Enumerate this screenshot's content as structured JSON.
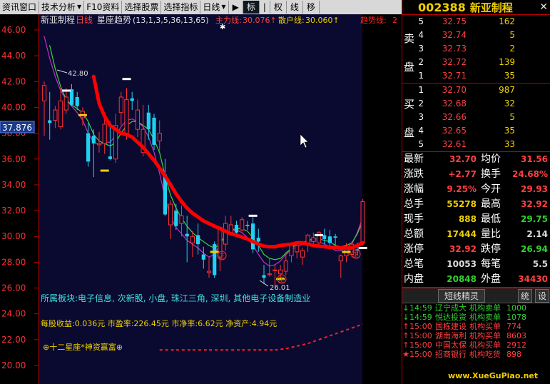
{
  "toolbar": {
    "items": [
      "资讯窗口",
      "技术分析",
      "F10资料",
      "选择股票",
      "选择指标",
      "日线"
    ],
    "play": "▶",
    "mark": "标",
    "tools": [
      "|",
      "权",
      "线",
      "移"
    ]
  },
  "chart": {
    "header": {
      "name": "新亚制程",
      "period": "日线",
      "indicator": "星座趋势",
      "params": "(13,1,3,5,36,13,65)",
      "zhuli_label": "主力线:",
      "zhuli_value": "30.076↑",
      "sanhu_label": "散户线:",
      "sanhu_value": "30.060↑",
      "qushi_label": "趋势线:",
      "qushi_value": "2"
    },
    "current_price_tag": "37.876",
    "high_mark": "42.80",
    "low_mark": "26.01",
    "zheng_glyph": "正",
    "sector_text": "所属板块:电子信息, 次新股, 小盘, 珠江三角, 深圳, 其他电子设备制造业",
    "finance_text": "每股收益:0.036元 市盈率:226.45元 市净率:6.62元 净资产:4.94元",
    "zodiac_text": "⊕十二星座*神资赢富⊕"
  },
  "chart_data": {
    "type": "candlestick",
    "ylim": [
      19,
      47
    ],
    "yticks": [
      "46.00",
      "44.00",
      "42.00",
      "40.00",
      "38.00",
      "36.00",
      "34.00",
      "32.00",
      "30.00",
      "28.00",
      "26.00",
      "24.00",
      "22.00",
      "20.00"
    ],
    "candles": [
      [
        40.5,
        42.0,
        37.8,
        41.7
      ],
      [
        39.0,
        41.2,
        37.5,
        38.8
      ],
      [
        39.0,
        40.1,
        38.4,
        39.8
      ],
      [
        38.5,
        41.5,
        38.3,
        40.5
      ],
      [
        39.8,
        41.5,
        39.5,
        40.8
      ],
      [
        41.4,
        41.8,
        40.1,
        40.2
      ],
      [
        40.8,
        41.2,
        39.8,
        40.1
      ],
      [
        39.2,
        40.0,
        38.6,
        39.7
      ],
      [
        38.0,
        38.8,
        35.4,
        35.8
      ],
      [
        37.8,
        38.3,
        34.6,
        37.2
      ],
      [
        37.1,
        38.1,
        36.5,
        37.2
      ],
      [
        37.2,
        39.4,
        36.4,
        38.7
      ],
      [
        36.2,
        38.9,
        35.9,
        36.0
      ],
      [
        36.0,
        39.5,
        35.7,
        38.6
      ],
      [
        39.6,
        41.2,
        38.6,
        40.8
      ],
      [
        38.0,
        41.5,
        37.5,
        40.6
      ],
      [
        40.7,
        41.2,
        39.8,
        40.5
      ],
      [
        38.3,
        40.6,
        37.7,
        39.8
      ],
      [
        36.5,
        40.2,
        36.2,
        38.3
      ],
      [
        39.6,
        40.2,
        37.5,
        38.3
      ],
      [
        39.2,
        39.5,
        36.7,
        37.1
      ],
      [
        37.4,
        39.0,
        36.6,
        38.0
      ],
      [
        34.8,
        36.0,
        31.6,
        31.7
      ],
      [
        30.9,
        32.8,
        29.8,
        32.5
      ],
      [
        32.0,
        32.5,
        30.5,
        30.8
      ],
      [
        31.0,
        32.4,
        30.0,
        31.6
      ],
      [
        30.2,
        31.6,
        28.0,
        30.0
      ],
      [
        29.5,
        30.4,
        28.4,
        30.0
      ],
      [
        30.1,
        31.0,
        28.6,
        29.4
      ],
      [
        28.6,
        29.2,
        27.5,
        28.2
      ],
      [
        27.2,
        28.4,
        26.8,
        27.3
      ],
      [
        29.4,
        29.6,
        26.8,
        27.0
      ],
      [
        28.4,
        30.8,
        27.3,
        30.7
      ],
      [
        29.4,
        31.6,
        28.9,
        31.0
      ],
      [
        30.3,
        31.6,
        30.1,
        30.9
      ],
      [
        30.9,
        31.2,
        30.2,
        30.3
      ],
      [
        30.5,
        31.5,
        30.4,
        31.3
      ],
      [
        30.9,
        31.2,
        30.5,
        30.8
      ],
      [
        31.0,
        31.5,
        28.7,
        29.0
      ],
      [
        29.9,
        30.6,
        28.8,
        29.6
      ],
      [
        27.0,
        27.8,
        26.3,
        26.8
      ],
      [
        27.1,
        28.3,
        26.9,
        27.1
      ],
      [
        27.4,
        27.8,
        26.2,
        27.4
      ],
      [
        27.1,
        27.8,
        26.6,
        27.4
      ],
      [
        27.3,
        28.8,
        27.0,
        28.1
      ],
      [
        28.5,
        29.5,
        28.0,
        29.4
      ],
      [
        28.8,
        29.6,
        28.3,
        29.3
      ],
      [
        28.4,
        29.1,
        27.8,
        28.9
      ],
      [
        29.3,
        30.2,
        28.8,
        30.1
      ],
      [
        29.6,
        30.3,
        29.2,
        29.9
      ],
      [
        29.5,
        30.4,
        29.1,
        30.3
      ],
      [
        30.1,
        30.6,
        29.4,
        29.8
      ],
      [
        30.0,
        30.5,
        29.2,
        29.5
      ],
      [
        30.0,
        30.2,
        29.0,
        29.9
      ],
      [
        28.1,
        28.6,
        26.8,
        28.5
      ],
      [
        28.5,
        29.5,
        28.0,
        29.2
      ],
      [
        28.6,
        29.6,
        28.4,
        29.4
      ],
      [
        29.0,
        29.5,
        28.5,
        28.9
      ],
      [
        29.5,
        32.9,
        29.3,
        32.7
      ]
    ],
    "zhuli_line": [
      [
        9,
        42.4
      ],
      [
        10,
        40.3
      ],
      [
        11,
        39.3
      ],
      [
        12,
        38.6
      ],
      [
        13,
        38.3
      ],
      [
        14,
        38.0
      ],
      [
        15,
        37.9
      ],
      [
        16,
        37.7
      ],
      [
        17,
        37.3
      ],
      [
        18,
        36.9
      ],
      [
        19,
        36.4
      ],
      [
        20,
        35.9
      ],
      [
        21,
        35.3
      ],
      [
        22,
        34.7
      ],
      [
        23,
        34.0
      ],
      [
        24,
        33.3
      ],
      [
        25,
        32.7
      ],
      [
        26,
        32.2
      ],
      [
        27,
        31.8
      ],
      [
        28,
        31.5
      ],
      [
        29,
        31.2
      ],
      [
        30,
        31.0
      ],
      [
        31,
        30.8
      ],
      [
        32,
        30.6
      ],
      [
        33,
        30.4
      ],
      [
        34,
        30.2
      ],
      [
        35,
        30.1
      ],
      [
        36,
        29.95
      ],
      [
        37,
        29.8
      ],
      [
        38,
        29.6
      ],
      [
        39,
        29.4
      ],
      [
        40,
        29.25
      ],
      [
        41,
        29.2
      ],
      [
        42,
        29.2
      ],
      [
        43,
        29.3
      ],
      [
        44,
        29.35
      ],
      [
        45,
        29.4
      ],
      [
        46,
        29.5
      ],
      [
        47,
        29.5
      ],
      [
        48,
        29.4
      ],
      [
        49,
        29.3
      ],
      [
        50,
        29.25
      ],
      [
        51,
        29.2
      ],
      [
        52,
        29.15
      ],
      [
        53,
        29.15
      ],
      [
        54,
        29.1
      ],
      [
        55,
        29.1
      ],
      [
        56,
        29.1
      ],
      [
        57,
        29.3
      ],
      [
        58,
        29.5
      ]
    ],
    "sanhu_line": [
      [
        1,
        44.8
      ],
      [
        2,
        43.0
      ],
      [
        3,
        41.6
      ],
      [
        4,
        40.6
      ],
      [
        5,
        40.2
      ],
      [
        6,
        39.9
      ],
      [
        7,
        39.6
      ],
      [
        8,
        38.9
      ],
      [
        9,
        37.9
      ],
      [
        10,
        37.4
      ],
      [
        11,
        37.2
      ],
      [
        12,
        37.0
      ],
      [
        13,
        37.3
      ],
      [
        14,
        38.0
      ],
      [
        15,
        38.6
      ],
      [
        16,
        38.9
      ],
      [
        17,
        38.9
      ],
      [
        18,
        38.6
      ],
      [
        19,
        38.3
      ],
      [
        20,
        37.5
      ],
      [
        21,
        36.5
      ],
      [
        22,
        34.7
      ],
      [
        23,
        33.2
      ],
      [
        24,
        32.2
      ],
      [
        25,
        31.4
      ],
      [
        26,
        30.8
      ],
      [
        27,
        30.3
      ],
      [
        28,
        29.9
      ],
      [
        29,
        29.6
      ],
      [
        30,
        29.3
      ],
      [
        31,
        29.1
      ],
      [
        32,
        29.4
      ],
      [
        33,
        30.1
      ],
      [
        34,
        30.5
      ],
      [
        35,
        30.6
      ],
      [
        36,
        30.6
      ],
      [
        37,
        30.4
      ],
      [
        38,
        29.9
      ],
      [
        39,
        29.3
      ],
      [
        40,
        28.6
      ],
      [
        41,
        28.3
      ],
      [
        42,
        28.2
      ],
      [
        43,
        28.3
      ],
      [
        44,
        28.7
      ],
      [
        45,
        29.1
      ],
      [
        46,
        29.4
      ],
      [
        47,
        29.5
      ],
      [
        48,
        29.7
      ],
      [
        49,
        29.8
      ],
      [
        50,
        29.8
      ],
      [
        51,
        29.7
      ],
      [
        52,
        29.6
      ],
      [
        53,
        29.3
      ],
      [
        54,
        29.2
      ],
      [
        55,
        29.3
      ],
      [
        56,
        29.5
      ],
      [
        57,
        30.2
      ],
      [
        58,
        31.2
      ]
    ],
    "magenta_line": [
      [
        0,
        45.5
      ],
      [
        1,
        43.8
      ],
      [
        2,
        42.4
      ],
      [
        3,
        41.3
      ],
      [
        4,
        40.6
      ],
      [
        5,
        40.1
      ],
      [
        6,
        39.6
      ],
      [
        7,
        39.0
      ],
      [
        8,
        38.0
      ],
      [
        9,
        37.3
      ],
      [
        10,
        37.1
      ],
      [
        11,
        37.3
      ],
      [
        12,
        37.3
      ],
      [
        13,
        37.8
      ],
      [
        14,
        38.5
      ],
      [
        15,
        39.0
      ],
      [
        16,
        39.1
      ],
      [
        17,
        38.9
      ],
      [
        18,
        38.5
      ],
      [
        19,
        37.7
      ],
      [
        20,
        36.5
      ],
      [
        21,
        34.9
      ],
      [
        22,
        33.0
      ],
      [
        23,
        31.5
      ],
      [
        24,
        30.7
      ],
      [
        25,
        30.2
      ],
      [
        26,
        29.7
      ],
      [
        27,
        29.4
      ],
      [
        28,
        29.1
      ],
      [
        29,
        28.7
      ],
      [
        30,
        28.4
      ],
      [
        31,
        28.6
      ],
      [
        32,
        29.4
      ],
      [
        33,
        30.1
      ],
      [
        34,
        30.4
      ],
      [
        35,
        30.5
      ],
      [
        36,
        30.3
      ],
      [
        37,
        29.9
      ],
      [
        38,
        29.3
      ],
      [
        39,
        28.6
      ],
      [
        40,
        28.0
      ],
      [
        41,
        27.7
      ],
      [
        42,
        27.8
      ],
      [
        43,
        28.1
      ],
      [
        44,
        28.6
      ],
      [
        45,
        29.0
      ],
      [
        46,
        29.2
      ],
      [
        47,
        29.4
      ],
      [
        48,
        29.6
      ],
      [
        49,
        29.7
      ],
      [
        50,
        29.6
      ],
      [
        51,
        29.4
      ],
      [
        52,
        29.2
      ],
      [
        53,
        28.9
      ],
      [
        54,
        28.9
      ],
      [
        55,
        29.1
      ],
      [
        56,
        29.4
      ],
      [
        57,
        30.3
      ],
      [
        58,
        31.5
      ]
    ],
    "bottom_dots": [
      [
        21,
        21.2
      ],
      [
        24,
        21.2
      ],
      [
        27,
        21.2
      ],
      [
        30,
        21.2
      ],
      [
        33,
        21.2
      ],
      [
        36,
        21.2
      ],
      [
        39,
        21.2
      ],
      [
        42,
        21.2
      ],
      [
        44,
        21.3
      ],
      [
        46,
        21.5
      ],
      [
        48,
        21.7
      ],
      [
        50,
        22.0
      ],
      [
        52,
        22.3
      ],
      [
        54,
        22.6
      ],
      [
        56,
        22.9
      ],
      [
        58,
        23.2
      ]
    ]
  },
  "quote": {
    "code": "002388",
    "name": "新亚制程",
    "close_glyph": "✕",
    "sell_side": [
      "卖",
      "盘"
    ],
    "buy_side": [
      "买",
      "盘"
    ],
    "asks": [
      {
        "lvl": "5",
        "price": "32.75",
        "vol": "162"
      },
      {
        "lvl": "4",
        "price": "32.74",
        "vol": "5"
      },
      {
        "lvl": "3",
        "price": "32.73",
        "vol": "2"
      },
      {
        "lvl": "2",
        "price": "32.72",
        "vol": "139"
      },
      {
        "lvl": "1",
        "price": "32.71",
        "vol": "35"
      }
    ],
    "bids": [
      {
        "lvl": "1",
        "price": "32.70",
        "vol": "987"
      },
      {
        "lvl": "2",
        "price": "32.68",
        "vol": "32"
      },
      {
        "lvl": "3",
        "price": "32.66",
        "vol": "5"
      },
      {
        "lvl": "4",
        "price": "32.65",
        "vol": "35"
      },
      {
        "lvl": "5",
        "price": "32.61",
        "vol": "33"
      }
    ],
    "stats": [
      {
        "k": "最新",
        "v": "32.70",
        "k2": "均价",
        "v2": "31.56"
      },
      {
        "k": "涨跌",
        "v": "+2.77",
        "k2": "换手",
        "v2": "24.68%"
      },
      {
        "k": "涨幅",
        "v": "9.25%",
        "k2": "今开",
        "v2": "29.93"
      },
      {
        "k": "总手",
        "v": "55278",
        "k2": "最高",
        "v2": "32.92"
      },
      {
        "k": "现手",
        "v": "888",
        "k2": "最低",
        "v2": "29.75"
      },
      {
        "k": "总额",
        "v": "17444",
        "k2": "量比",
        "v2": "2.14"
      },
      {
        "k": "涨停",
        "v": "32.92",
        "k2": "跌停",
        "v2": "26.94"
      },
      {
        "k": "总笔",
        "v": "10053",
        "k2": "每笔",
        "v2": "5.5"
      },
      {
        "k": "内盘",
        "v": "20848",
        "k2": "外盘",
        "v2": "34430"
      }
    ],
    "short_title": "短线精灵",
    "btn1": "统",
    "btn2": "设",
    "short_rows": [
      {
        "arrow": "↓",
        "time": "14:59",
        "name": "辽宁成大",
        "action": "机构卖单",
        "vol": "1000"
      },
      {
        "arrow": "↓",
        "time": "14:59",
        "name": "悦达投资",
        "action": "机构卖单",
        "vol": "1078"
      },
      {
        "arrow": "↑",
        "time": "15:00",
        "name": "国栋建设",
        "action": "机构买单",
        "vol": "774"
      },
      {
        "arrow": "↑",
        "time": "15:00",
        "name": "湖南海利",
        "action": "机构买单",
        "vol": "8603"
      },
      {
        "arrow": "↑",
        "time": "15:00",
        "name": "中国太保",
        "action": "机构买单",
        "vol": "2912"
      },
      {
        "arrow": "★",
        "time": "15:00",
        "name": "招商银行",
        "action": "机构吃货",
        "vol": "898"
      }
    ],
    "watermark": "www.XueGuPiao.net"
  }
}
